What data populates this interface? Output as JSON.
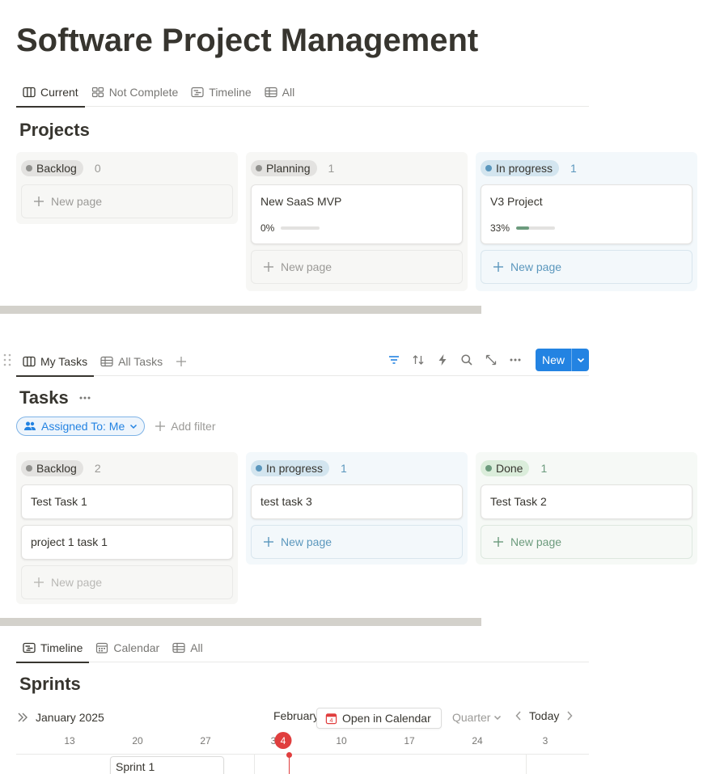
{
  "page": {
    "title": "Software Project Management"
  },
  "projects": {
    "tabs": [
      {
        "label": "Current",
        "icon": "board-icon",
        "active": true
      },
      {
        "label": "Not Complete",
        "icon": "gallery-icon",
        "active": false
      },
      {
        "label": "Timeline",
        "icon": "timeline-icon",
        "active": false
      },
      {
        "label": "All",
        "icon": "table-icon",
        "active": false
      }
    ],
    "title": "Projects",
    "columns": [
      {
        "status": "Backlog",
        "count": "0",
        "color": "#91918e",
        "cards": []
      },
      {
        "status": "Planning",
        "count": "1",
        "color": "#91918e",
        "cards": [
          {
            "title": "New SaaS MVP",
            "progress_label": "0%",
            "progress": 0
          }
        ]
      },
      {
        "status": "In progress",
        "count": "1",
        "color": "#5b97bd",
        "cards": [
          {
            "title": "V3 Project",
            "progress_label": "33%",
            "progress": 0.33
          }
        ]
      }
    ],
    "new_page_label": "New page"
  },
  "tasks": {
    "tabs": [
      {
        "label": "My Tasks",
        "icon": "board-icon",
        "active": true
      },
      {
        "label": "All Tasks",
        "icon": "table-icon",
        "active": false
      }
    ],
    "toolbar": {
      "new_label": "New"
    },
    "title": "Tasks",
    "filter": {
      "assigned_label": "Assigned To: Me",
      "add_filter_label": "Add filter"
    },
    "columns": [
      {
        "status": "Backlog",
        "count": "2",
        "color": "#91918e",
        "cards": [
          "Test Task 1",
          "project 1 task 1"
        ]
      },
      {
        "status": "In progress",
        "count": "1",
        "color": "#5b97bd",
        "cards": [
          "test task 3"
        ]
      },
      {
        "status": "Done",
        "count": "1",
        "color": "#6c9b7d",
        "cards": [
          "Test Task 2"
        ]
      }
    ],
    "new_page_label": "New page"
  },
  "sprints": {
    "tabs": [
      {
        "label": "Timeline",
        "icon": "timeline-icon",
        "active": true
      },
      {
        "label": "Calendar",
        "icon": "calendar-icon",
        "active": false
      },
      {
        "label": "All",
        "icon": "table-icon",
        "active": false
      }
    ],
    "title": "Sprints",
    "month_left": "January 2025",
    "month_right": "February",
    "open_calendar_label": "Open in Calendar",
    "calendar_badge": "4",
    "range_label": "Quarter",
    "today_label": "Today",
    "days": [
      "13",
      "20",
      "27",
      "3",
      "10",
      "17",
      "24",
      "3"
    ],
    "today_day": "4",
    "sprint_label": "Sprint 1"
  },
  "colors": {
    "accent": "#2383e2",
    "today": "#e03e3e"
  }
}
